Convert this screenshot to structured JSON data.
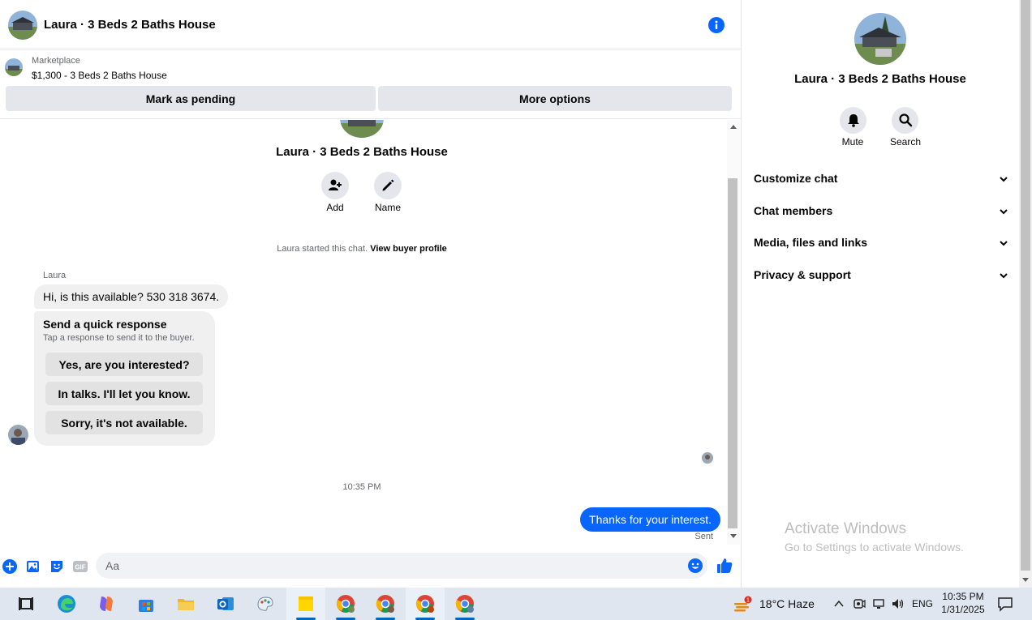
{
  "header": {
    "title": "Laura · 3 Beds 2 Baths House"
  },
  "listing": {
    "label": "Marketplace",
    "value": "$1,300 - 3 Beds 2 Baths House",
    "pending_button": "Mark as pending",
    "more_button": "More options"
  },
  "thread": {
    "title": "Laura · 3 Beds 2 Baths House",
    "actions": {
      "add": "Add",
      "name": "Name"
    },
    "start_note": "Laura started this chat.",
    "start_link": "View buyer profile",
    "sender": "Laura",
    "incoming_message": "Hi, is this available? 530 318 3674.",
    "quick_title": "Send a quick response",
    "quick_sub": "Tap a response to send it to the buyer.",
    "quick_responses": [
      "Yes, are you interested?",
      "In talks. I'll let you know.",
      "Sorry, it's not available."
    ],
    "timestamp": "10:35 PM",
    "outgoing_message": "Thanks for your interest.",
    "status": "Sent"
  },
  "composer": {
    "placeholder": "Aa"
  },
  "info_panel": {
    "title": "Laura · 3 Beds 2 Baths House",
    "actions": {
      "mute": "Mute",
      "search": "Search"
    },
    "sections": [
      "Customize chat",
      "Chat members",
      "Media, files and links",
      "Privacy & support"
    ]
  },
  "watermark": {
    "title": "Activate Windows",
    "subtitle": "Go to Settings to activate Windows."
  },
  "taskbar": {
    "weather": "18°C  Haze",
    "weather_badge": "1",
    "language": "ENG",
    "time": "10:35 PM",
    "date": "1/31/2025"
  },
  "colors": {
    "accent": "#0866ff",
    "bubble_in": "#f0f0f0",
    "button_gray": "#e4e6eb"
  }
}
